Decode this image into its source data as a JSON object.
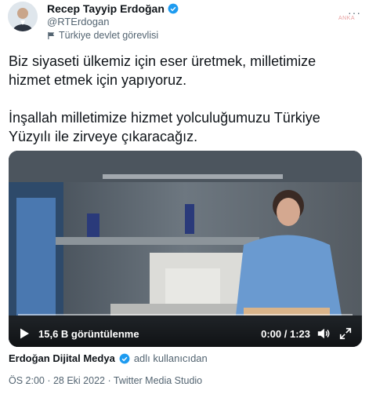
{
  "author": {
    "name": "Recep Tayyip Erdoğan",
    "handle": "@RTErdogan",
    "label": "Türkiye devlet görevlisi"
  },
  "badge_text": "ANKA",
  "tweet": {
    "text": "Biz siyaseti ülkemiz için eser üretmek, milletimize hizmet etmek için yapıyoruz.\n\nİnşallah milletimize hizmet yolculuğumuzu Türkiye Yüzyılı ile zirveye çıkaracağız."
  },
  "video": {
    "views": "15,6 B görüntülenme",
    "time": "0:00 / 1:23",
    "progress": 0
  },
  "attribution": {
    "channel": "Erdoğan Dijital Medya",
    "suffix": "adlı kullanıcıdan"
  },
  "meta": "ÖS 2:00 · 28 Eki 2022 · Twitter Media Studio",
  "colors": {
    "verified": "#1d9bf0",
    "text": "#0f1419",
    "muted": "#536471"
  },
  "icons": [
    "verified-icon",
    "flag-icon",
    "more-icon",
    "play-icon",
    "volume-icon",
    "fullscreen-icon"
  ]
}
